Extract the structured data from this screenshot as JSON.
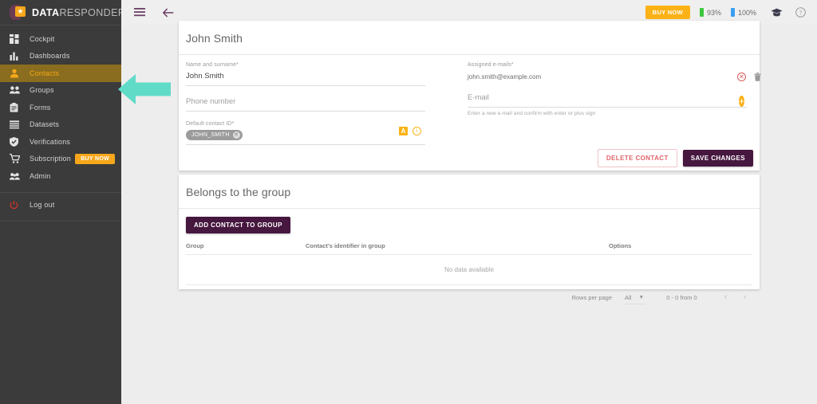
{
  "brand": {
    "name_bold": "DATA",
    "name_light": "RESPONDER",
    "logo_star": "★",
    "accent_orange": "#f7a71a",
    "accent_purple": "#46173f",
    "sidebar_bg": "#3b3b3b",
    "active_bg": "#8a6d1e"
  },
  "sidebar": {
    "items": [
      {
        "label": "Cockpit",
        "icon": "grid-icon",
        "active": false
      },
      {
        "label": "Dashboards",
        "icon": "bar-chart-icon",
        "active": false
      },
      {
        "label": "Contacts",
        "icon": "person-icon",
        "active": true
      },
      {
        "label": "Groups",
        "icon": "people-icon",
        "active": false
      },
      {
        "label": "Forms",
        "icon": "clipboard-icon",
        "active": false
      },
      {
        "label": "Datasets",
        "icon": "list-icon",
        "active": false
      },
      {
        "label": "Verifications",
        "icon": "shield-check-icon",
        "active": false
      },
      {
        "label": "Subscription",
        "icon": "cart-icon",
        "active": false,
        "badge": "BUY NOW"
      },
      {
        "label": "Admin",
        "icon": "admin-people-icon",
        "active": false
      }
    ],
    "logout": {
      "label": "Log out",
      "icon": "power-icon"
    }
  },
  "topbar": {
    "menu_icon": "hamburger-icon",
    "back_icon": "arrow-left-icon",
    "buy_now": "BUY NOW",
    "stat_green": "93%",
    "stat_blue": "100%",
    "cap_icon": "graduation-cap-icon",
    "help_icon": "help-circle-icon"
  },
  "contact_card": {
    "title": "John Smith",
    "name_label": "Name and surname*",
    "name_value": "John Smith",
    "phone_placeholder": "Phone number",
    "contact_id_label": "Default contact ID*",
    "contact_id_chip": "JOHN_SMITH",
    "chip_remove": "✕",
    "a_badge": "A",
    "info_badge": "i",
    "emails_label": "Assigned e-mails*",
    "email_value": "john.smith@example.com",
    "email_remove_icon": "remove-circle-icon",
    "email_delete_icon": "trash-icon",
    "email_input_placeholder": "E-mail",
    "email_add_icon": "plus-circle-icon",
    "email_add_symbol": "+",
    "email_help": "Enter a new e-mail and confirm with enter or plus sign",
    "delete_button": "DELETE CONTACT",
    "save_button": "SAVE CHANGES"
  },
  "group_card": {
    "title": "Belongs to the group",
    "add_button": "ADD CONTACT TO GROUP",
    "columns": [
      "Group",
      "Contact's identifier in group",
      "Options"
    ],
    "rows": [],
    "empty_text": "No data available",
    "rows_per_page_label": "Rows per page",
    "rows_per_page_value": "All",
    "range_text": "0 - 0 from 0",
    "prev_icon": "chevron-left-icon",
    "next_icon": "chevron-right-icon"
  },
  "annotation": {
    "arrow_color": "#5fdbc8",
    "points_to": "Contacts"
  }
}
